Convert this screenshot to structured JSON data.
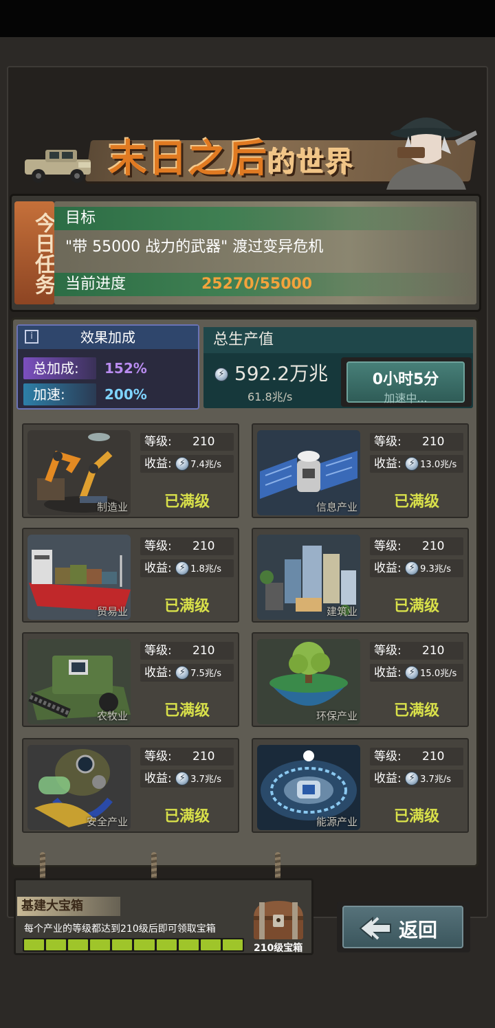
{
  "banner": {
    "title_main": "末日之后",
    "title_tail": "的世界"
  },
  "task": {
    "side_label": "今日任务",
    "goal_label": "目标",
    "goal_text": "\"带 55000 战力的武器\" 渡过变异危机",
    "progress_label": "当前进度",
    "progress_value": "25270/55000"
  },
  "bonus": {
    "title": "效果加成",
    "total_label": "总加成:",
    "total_value": "152%",
    "speed_label": "加速:",
    "speed_value": "200%"
  },
  "output": {
    "title": "总生产值",
    "amount": "592.2万兆",
    "rate": "61.8兆/s"
  },
  "speed_button": {
    "time": "0小时5分",
    "status": "加速中..."
  },
  "industries": [
    {
      "name": "制造业",
      "level_label": "等级:",
      "level": "210",
      "earn_label": "收益:",
      "rate": "7.4兆/s",
      "status": "已满级"
    },
    {
      "name": "信息产业",
      "level_label": "等级:",
      "level": "210",
      "earn_label": "收益:",
      "rate": "13.0兆/s",
      "status": "已满级"
    },
    {
      "name": "贸易业",
      "level_label": "等级:",
      "level": "210",
      "earn_label": "收益:",
      "rate": "1.8兆/s",
      "status": "已满级"
    },
    {
      "name": "建筑业",
      "level_label": "等级:",
      "level": "210",
      "earn_label": "收益:",
      "rate": "9.3兆/s",
      "status": "已满级"
    },
    {
      "name": "农牧业",
      "level_label": "等级:",
      "level": "210",
      "earn_label": "收益:",
      "rate": "7.5兆/s",
      "status": "已满级"
    },
    {
      "name": "环保产业",
      "level_label": "等级:",
      "level": "210",
      "earn_label": "收益:",
      "rate": "15.0兆/s",
      "status": "已满级"
    },
    {
      "name": "安全产业",
      "level_label": "等级:",
      "level": "210",
      "earn_label": "收益:",
      "rate": "3.7兆/s",
      "status": "已满级"
    },
    {
      "name": "能源产业",
      "level_label": "等级:",
      "level": "210",
      "earn_label": "收益:",
      "rate": "3.7兆/s",
      "status": "已满级"
    }
  ],
  "chest": {
    "title": "基建大宝箱",
    "description": "每个产业的等级都达到210级后即可领取宝箱",
    "progress_fraction": 1.0,
    "chest_label": "210级宝箱"
  },
  "back_button": {
    "label": "返回"
  },
  "colors": {
    "accent_orange": "#f3a33c",
    "max_yellow": "#d8e04a",
    "bonus_purple": "#b98cf0",
    "bonus_blue": "#7fd4ff",
    "progress_green": "#9fc52a"
  }
}
